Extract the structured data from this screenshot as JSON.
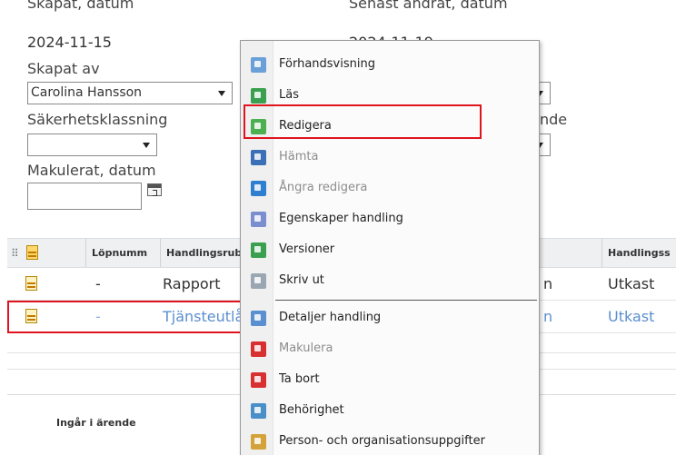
{
  "form": {
    "created_date_label": "Skapat, datum",
    "created_date_value": "2024-11-15",
    "modified_date_label": "Senast ändrat, datum",
    "modified_date_value": "2024-11-19",
    "created_by_label": "Skapat av",
    "created_by_value": "Carolina Hansson",
    "security_label": "Säkerhetsklassning",
    "security_value": "",
    "cancelled_date_label": "Makulerat, datum",
    "cancelled_date_value": "",
    "partial_right_label": "nde"
  },
  "grid": {
    "columns": [
      "Löpnumm",
      "Handlingsrub",
      "Handlingss"
    ],
    "rows": [
      {
        "number": "-",
        "heading": "Rapport",
        "extra": "n",
        "status": "Utkast"
      },
      {
        "number": "-",
        "heading": "Tjänsteutlå",
        "extra": "n",
        "status": "Utkast"
      }
    ]
  },
  "case_section": {
    "label": "Ingår i ärende"
  },
  "context_menu": {
    "items": [
      {
        "label": "Förhandsvisning",
        "icon": "preview-icon",
        "disabled": false,
        "color": "#6a9fd8"
      },
      {
        "label": "Läs",
        "icon": "read-icon",
        "disabled": false,
        "color": "#3aa050"
      },
      {
        "label": "Redigera",
        "icon": "edit-icon",
        "disabled": false,
        "color": "#4caf50"
      },
      {
        "label": "Hämta",
        "icon": "fetch-icon",
        "disabled": true,
        "color": "#3b6fb6"
      },
      {
        "label": "Ångra redigera",
        "icon": "undo-edit-icon",
        "disabled": true,
        "color": "#2f7fd0"
      },
      {
        "label": "Egenskaper handling",
        "icon": "properties-icon",
        "disabled": false,
        "color": "#7b8fd0"
      },
      {
        "label": "Versioner",
        "icon": "versions-icon",
        "disabled": false,
        "color": "#3aa050"
      },
      {
        "label": "Skriv ut",
        "icon": "print-icon",
        "disabled": false,
        "color": "#9aa6b2"
      },
      {
        "label": "Detaljer handling",
        "icon": "details-icon",
        "disabled": false,
        "color": "#5a8fd0"
      },
      {
        "label": "Makulera",
        "icon": "cancel-document-icon",
        "disabled": true,
        "color": "#d83030"
      },
      {
        "label": "Ta bort",
        "icon": "delete-icon",
        "disabled": false,
        "color": "#d83030"
      },
      {
        "label": "Behörighet",
        "icon": "permissions-icon",
        "disabled": false,
        "color": "#4a8fc8"
      },
      {
        "label": "Person- och organisationsuppgifter",
        "icon": "person-org-icon",
        "disabled": false,
        "color": "#d4a23a"
      }
    ]
  },
  "colors": {
    "highlight": "#e0141e",
    "link_blue": "#3a6fb0"
  }
}
